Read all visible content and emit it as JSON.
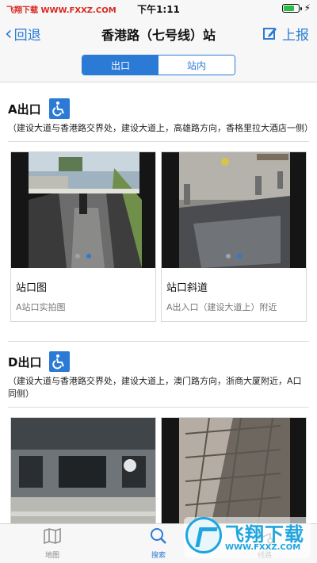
{
  "status_bar": {
    "watermark": "飞翔下载 WWW.FXXZ.COM",
    "time": "下午1:11",
    "battery_level": 0.7
  },
  "nav": {
    "back_label": "回退",
    "title": "香港路（七号线）站",
    "report_label": "上报"
  },
  "segments": [
    {
      "label": "出口",
      "active": true
    },
    {
      "label": "站内",
      "active": false
    }
  ],
  "exits": [
    {
      "name": "A出口",
      "description": "（建设大道与香港路交界处，建设大道上，高雄路方向，香格里拉大酒店一侧）",
      "cards": [
        {
          "caption": "站口图",
          "sub": "A站口实拍图"
        },
        {
          "caption": "站口斜道",
          "sub": "A出入口（建设大道上）附近"
        }
      ]
    },
    {
      "name": "D出口",
      "description": "（建设大道与香港路交界处，建设大道上，澳门路方向，浙商大厦附近，A口同侧）",
      "cards": [
        {},
        {}
      ]
    }
  ],
  "tabbar": [
    {
      "label": "地图",
      "icon": "map-icon",
      "active": false
    },
    {
      "label": "搜索",
      "icon": "search-icon",
      "active": true
    },
    {
      "label": "线路",
      "icon": "route-icon",
      "active": false
    }
  ],
  "watermark": {
    "text": "飞翔下载",
    "url": "WWW.FXXZ.COM"
  },
  "colors": {
    "accent": "#2b7bd6",
    "watermark": "#1fa5e0"
  }
}
